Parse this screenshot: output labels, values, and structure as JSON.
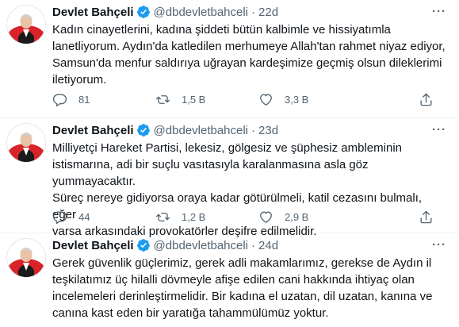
{
  "tweets": [
    {
      "author": "Devlet Bahçeli",
      "handle": "@dbdevletbahceli",
      "dot": "·",
      "time": "22d",
      "text": "Kadın cinayetlerini, kadına şiddeti bütün kalbimle ve hissiyatımla\nlanetliyorum. Aydın'da katledilen merhumeye Allah'tan rahmet niyaz ediyor,\nSamsun'da menfur saldırıya uğrayan kardeşimize geçmiş olsun dileklerimi\niletiyorum.",
      "replies": "81",
      "retweets": "1,5 B",
      "likes": "3,3 B"
    },
    {
      "author": "Devlet Bahçeli",
      "handle": "@dbdevletbahceli",
      "dot": "·",
      "time": "23d",
      "text": "Milliyetçi Hareket Partisi, lekesiz, gölgesiz ve şüphesiz ambleminin\nistismarına, adi bir suçlu vasıtasıyla karalanmasına asla göz yummayacaktır.\nSüreç nereye gidiyorsa oraya kadar götürülmeli, katil cezasını bulmalı, eğer\nvarsa arkasındaki provokatörler deşifre edilmelidir.",
      "replies": "44",
      "retweets": "1,2 B",
      "likes": "2,9 B"
    },
    {
      "author": "Devlet Bahçeli",
      "handle": "@dbdevletbahceli",
      "dot": "·",
      "time": "24d",
      "text": "Gerek güvenlik güçlerimiz, gerek adli makamlarımız, gerekse de Aydın il\nteşkilatımız üç hilalli dövmeyle afişe edilen cani hakkında ihtiyaç olan\nincelemeleri derinleştirmelidir. Bir kadına el uzatan, dil uzatan, kanına ve\ncanına kast eden bir yaratığa tahammülümüz yoktur."
    }
  ],
  "more_glyph": "···",
  "colors": {
    "verified": "#1d9bf0",
    "muted": "#536471",
    "text": "#0f1419",
    "avatar_red": "#d8232a"
  }
}
